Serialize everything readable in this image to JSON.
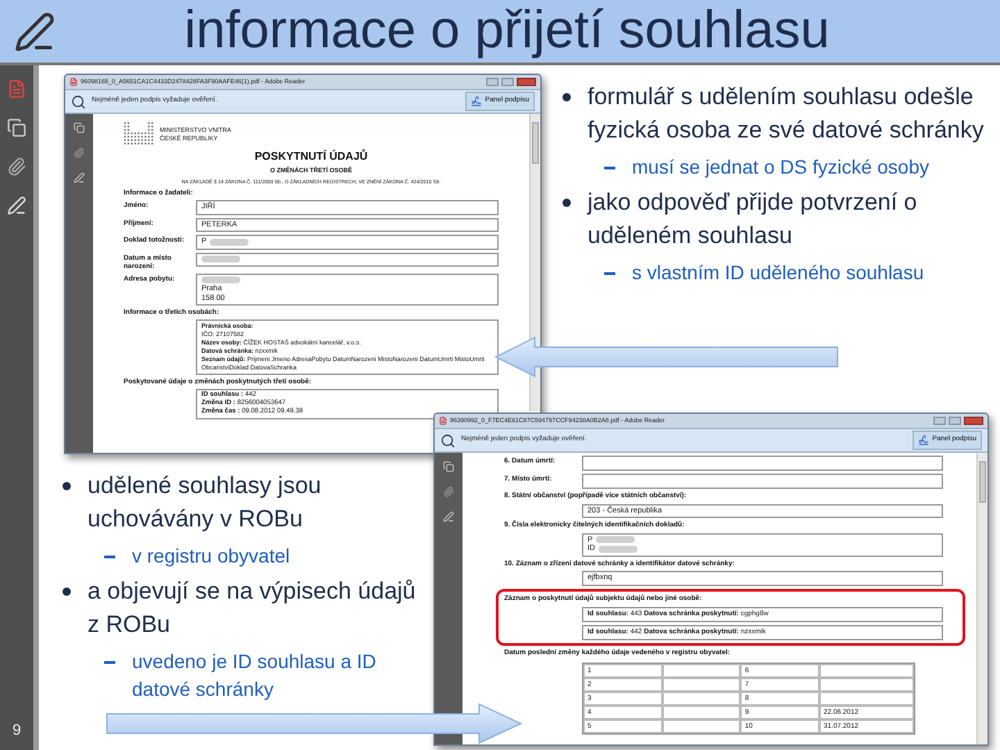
{
  "title": "informace o přijetí souhlasu",
  "slide_number": "9",
  "bullets_right": [
    {
      "text": "formulář s udělením souhlasu odešle fyzická osoba ze své datové schránky",
      "children": [
        {
          "text": "musí se jednat o DS fyzické osoby"
        }
      ]
    },
    {
      "text": "jako odpověď přijde potvrzení o uděleném souhlasu",
      "children": [
        {
          "text": "s vlastním ID uděleného souhlasu"
        }
      ]
    }
  ],
  "bullets_left": [
    {
      "text": "udělené souhlasy jsou uchovávány v ROBu",
      "children": [
        {
          "text": "v registru obyvatel"
        }
      ]
    },
    {
      "text": "a objevují se na výpisech údajů z ROBu",
      "children": [
        {
          "text": "uvedeno je ID souhlasu a ID datové schránky"
        }
      ]
    }
  ],
  "window_1": {
    "title": "96098165_0_A5651CA1C4433D2478428FA3F90AAFE46(1).pdf - Adobe Reader",
    "notice": "Nejméně jeden podpis vyžaduje ověření.",
    "panel_button": "Panel podpisu",
    "ministry": [
      "MINISTERSTVO VNITRA",
      "ČESKÉ REPUBLIKY"
    ],
    "heading": "POSKYTNUTÍ ÚDAJŮ",
    "subheading": "O ZMĚNÁCH TŘETÍ OSOBĚ",
    "legal": "NA ZÁKLADĚ § 14 ZÁKONA Č. 111/2009 Sb., O ZÁKLADNÍCH REGISTRECH, VE ZNĚNÍ ZÁKONA Č. 424/2010 Sb.",
    "section_1": "Informace o žadateli:",
    "fields": [
      {
        "label": "Jméno:",
        "lines": [
          {
            "text": "JIŘÍ",
            "redacted": false
          }
        ]
      },
      {
        "label": "Příjmení:",
        "lines": [
          {
            "text": "PETERKA",
            "redacted": false
          }
        ]
      },
      {
        "label": "Doklad totožnosti:",
        "lines": [
          {
            "text": "P",
            "redacted": true
          }
        ]
      },
      {
        "label": "Datum a místo narození:",
        "lines": [
          {
            "redacted": true
          }
        ]
      },
      {
        "label": "Adresa pobytu:",
        "lines": [
          {
            "redacted": true
          },
          {
            "text": "Praha",
            "redacted": false
          },
          {
            "text": "158 00",
            "redacted": false
          }
        ]
      }
    ],
    "section_2": "Informace o třetích osobách:",
    "third_party": [
      "**Právnická osoba:**",
      "IČO: 27107582",
      "**Název osoby:** ČÍŽEK HOSTAŠ advokátní kancelář, v.o.s.",
      "**Datová schránka:** nzxxmik",
      "**Seznam údajů:** Prijmeni Jmeno AdresaPobytu DatumNarozeni MistoNarozeni DatumUmrti MistoUmrti ObcanstviDoklad DatovaSchranka"
    ],
    "section_3": "Poskytované údaje o změnách poskytnutých třetí osobě:",
    "changes": [
      "**ID souhlasu :** 442",
      "**Změna ID :** 8256004053647",
      "**Změna čas :** 09.08.2012  09.49.38"
    ]
  },
  "window_2": {
    "title": "96390992_0_F7EC4E61C87C594797CCF94238A0B2A8.pdf - Adobe Reader",
    "notice": "Nejméně jeden podpis vyžaduje ověření.",
    "panel_button": "Panel podpisu",
    "rows": [
      {
        "kind": "inline",
        "label": "6. Datum úmrtí:",
        "lines": []
      },
      {
        "kind": "inline",
        "label": "7. Místo úmrtí:",
        "lines": []
      },
      {
        "kind": "block",
        "label": "8. Státní občanství (popřípadě více státních občanství):",
        "lines": [
          {
            "text": "203 - Česká republika",
            "redacted": false
          }
        ]
      },
      {
        "kind": "block",
        "label": "9. Čísla elektronicky čitelných identifikačních dokladů:",
        "lines": [
          {
            "text": "P",
            "redacted": true
          },
          {
            "text": "ID",
            "redacted": true
          }
        ]
      },
      {
        "kind": "block",
        "label": "10. Záznam o zřízení datové schránky a identifikátor datové schránky:",
        "lines": [
          {
            "text": "ejfbxnq",
            "redacted": false
          }
        ]
      }
    ],
    "consent_section": {
      "label": "Záznam o poskytnutí údajů subjektu údajů nebo jiné osobě:",
      "highlighted": true,
      "entries": [
        "**Id souhlasu:** 443   **Datova schránka poskytnutí:** cgphg8w",
        "**Id souhlasu:** 442   **Datova schránka poskytnutí:** nzxxmik"
      ]
    },
    "table_label": "Datum poslední změny každého údaje vedeného v registru obyvatel:",
    "table_rows": [
      [
        "1",
        "",
        "6",
        ""
      ],
      [
        "2",
        "",
        "7",
        ""
      ],
      [
        "3",
        "",
        "8",
        ""
      ],
      [
        "4",
        "",
        "9",
        "22.06.2012"
      ],
      [
        "5",
        "",
        "10",
        "31.07.2012"
      ]
    ]
  }
}
